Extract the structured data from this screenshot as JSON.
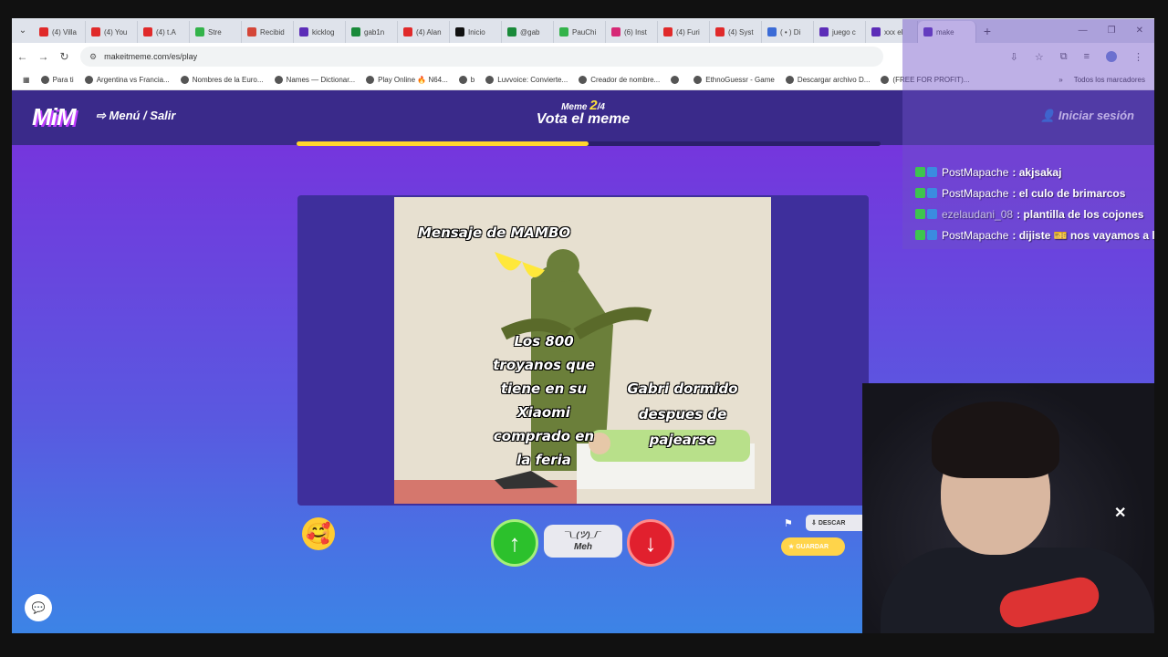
{
  "browser": {
    "tabs": [
      {
        "label": "(4) Villa",
        "color": "#e02a2a"
      },
      {
        "label": "(4) You",
        "color": "#e02a2a"
      },
      {
        "label": "(4) t.A",
        "color": "#e02a2a"
      },
      {
        "label": "Stre",
        "color": "#33b34a"
      },
      {
        "label": "Recibid",
        "color": "#d44638"
      },
      {
        "label": "kicklog",
        "color": "#5c2db8"
      },
      {
        "label": "gab1n",
        "color": "#1a8a3a"
      },
      {
        "label": "(4) Alan",
        "color": "#e02a2a"
      },
      {
        "label": "Inicio",
        "color": "#111111"
      },
      {
        "label": "@gab",
        "color": "#1a8a3a"
      },
      {
        "label": "PauChi",
        "color": "#33b34a"
      },
      {
        "label": "(6) Inst",
        "color": "#d62976"
      },
      {
        "label": "(4) Furi",
        "color": "#e02a2a"
      },
      {
        "label": "(4) Syst",
        "color": "#e02a2a"
      },
      {
        "label": "( • ) Di",
        "color": "#3b6bd6"
      },
      {
        "label": "juego c",
        "color": "#5c2db8"
      },
      {
        "label": "xxx el",
        "color": "#5c2db8"
      },
      {
        "label": "make",
        "color": "#5c2db8"
      }
    ],
    "active_tab_label": "make",
    "url": "makeitmeme.com/es/play",
    "bookmarks": [
      "Para ti",
      "Argentina vs Francia...",
      "Nombres de la Euro...",
      "Names — Dictionar...",
      "Play Online 🔥 N64...",
      "b",
      "Luvvoice: Convierte...",
      "Creador de nombre...",
      "",
      "EthnoGuessr - Game",
      "Descargar archivo D...",
      "(FREE FOR PROFIT)..."
    ],
    "bookmarks_more": "»",
    "all_bookmarks": "Todos los marcadores"
  },
  "site": {
    "logo": "MiM",
    "menu_link": "⇨ Menú / Salir",
    "round_prefix": "Meme",
    "round_current": "2",
    "round_total": "/4",
    "title": "Vota el meme",
    "login": "Iniciar sesión",
    "progress": 0.5
  },
  "meme": {
    "caption_top": "Mensaje de MAMBO",
    "caption_mid": "Los 800 troyanos que tiene en su Xiaomi comprado en la feria",
    "caption_right": "Gabri dormido despues de pajearse"
  },
  "controls": {
    "meh_face": "¯\\_(ツ)_/¯",
    "meh_label": "Meh",
    "download": "DESCAR",
    "save": "GUARDAR"
  },
  "stream_chat": [
    {
      "user": "PostMapache",
      "msg": ": akjsakaj",
      "alt": false
    },
    {
      "user": "PostMapache",
      "msg": ": el culo de brimarcos",
      "alt": false
    },
    {
      "user": "ezelaudani_08",
      "msg": ": plantilla de los cojones",
      "alt": true
    },
    {
      "user": "PostMapache",
      "msg": ": dijiste 🎫 nos vayamos a la",
      "alt": false
    }
  ],
  "colors": {
    "accent_yellow": "#ffd52e",
    "vote_up": "#2cc12c",
    "vote_down": "#e1202e"
  }
}
